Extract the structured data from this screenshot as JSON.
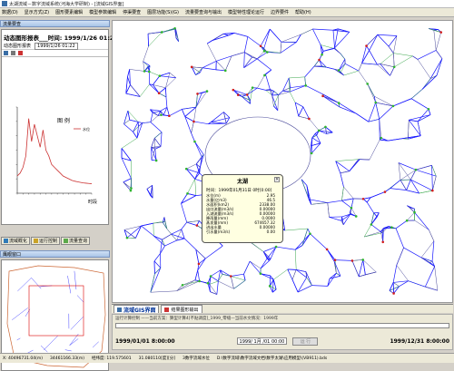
{
  "window": {
    "title": "太湖流域－数字流域系统(河海大学研制) - [流域GIS界面]"
  },
  "menu": [
    "数据(D)",
    "显示方式(Z)",
    "图形要素编辑",
    "模型参数编辑",
    "停渠要查",
    "图层功能(S)(G)",
    "流量要查询与输出",
    "模型特性理论运行",
    "边界要件",
    "帮助(H)"
  ],
  "left_panel": {
    "header": "流量要查",
    "dynamic_title": "动态图形报表___时间: 1999/1/26 01:22",
    "dynamic_row_label": "动态图形报表",
    "dynamic_row_value": "1999/1/26 01:22",
    "chart_legend_label": "图  例",
    "chart_legend_item": "水位",
    "x_axis_label": "时段",
    "tabs": [
      {
        "label": "流域概化",
        "icon": "map-icon"
      },
      {
        "label": "运行控制",
        "icon": "control-icon"
      },
      {
        "label": "流量查询",
        "icon": "query-icon"
      }
    ],
    "eagle_header": "鹰眼窗口"
  },
  "popup": {
    "name": "太湖",
    "subtitle": "时间：1999年01月31日 0时[0:00]",
    "rows": [
      {
        "k": "水位(m)",
        "v": "2.95"
      },
      {
        "k": "水量(亿m3)",
        "v": "46.5"
      },
      {
        "k": "水面积(km2)",
        "v": "2338.00"
      },
      {
        "k": "出口流量(m3/s)",
        "v": "0.00000"
      },
      {
        "k": "入湖流量(m3/s)",
        "v": "0.00000"
      },
      {
        "k": "降雨量(mm)",
        "v": "0.0000"
      },
      {
        "k": "蒸发量(mm)",
        "v": "674657.32"
      },
      {
        "k": "进出水量",
        "v": "0.00000"
      },
      {
        "k": "引水量(m3/s)",
        "v": "0.00"
      }
    ]
  },
  "bottom_tabs": [
    {
      "label": "流域GIS界面",
      "active": true
    },
    {
      "label": "结果图形输出",
      "active": false
    }
  ],
  "sim": {
    "status": "运行计算控制 ——当前方案：算型计算4[不贴调度]_1999_零缝—当前水文情况：1999年",
    "progress": 0.0,
    "start": "1999/01/01 8:00:00",
    "current": "1999/ 1月 /01 00:00",
    "run_label": "运 行",
    "end": "1999/12/31 8:00:00"
  },
  "statusbar": [
    "X: 40496731.04(m)",
    "34461166.33(m)",
    "经纬度: 119.575601",
    "31.080110[度][分]",
    "3数字流域水位",
    "D:\\数字流域\\数字流域文档\\数字太湖\\应用模型\\(VB911).bds"
  ],
  "colors": {
    "road_primary": "#1a1aff",
    "road_secondary": "#4a4a9a",
    "rivers_green": "#38a64a",
    "boundary": "#cc6633",
    "node_green": "#2eb52e",
    "node_red": "#d21e1e",
    "chart_line": "#c33"
  },
  "chart_data": {
    "type": "line",
    "title": "",
    "xlabel": "时段",
    "ylabel": "",
    "x": [
      0,
      1,
      2,
      3,
      4,
      5,
      6,
      7,
      8,
      9,
      10,
      11,
      12,
      13,
      14,
      15,
      16,
      17,
      18,
      19,
      20,
      21,
      22,
      23,
      24,
      25,
      26
    ],
    "series": [
      {
        "name": "水位",
        "values": [
          0.6,
          0.7,
          0.9,
          1.3,
          2.6,
          1.8,
          2.4,
          2.0,
          1.6,
          2.2,
          1.5,
          1.3,
          1.0,
          0.9,
          0.8,
          0.7,
          0.6,
          0.55,
          0.5,
          0.45,
          0.42,
          0.4,
          0.38,
          0.36,
          0.35,
          0.34,
          0.33
        ]
      }
    ],
    "ylim": [
      0,
      3
    ]
  }
}
